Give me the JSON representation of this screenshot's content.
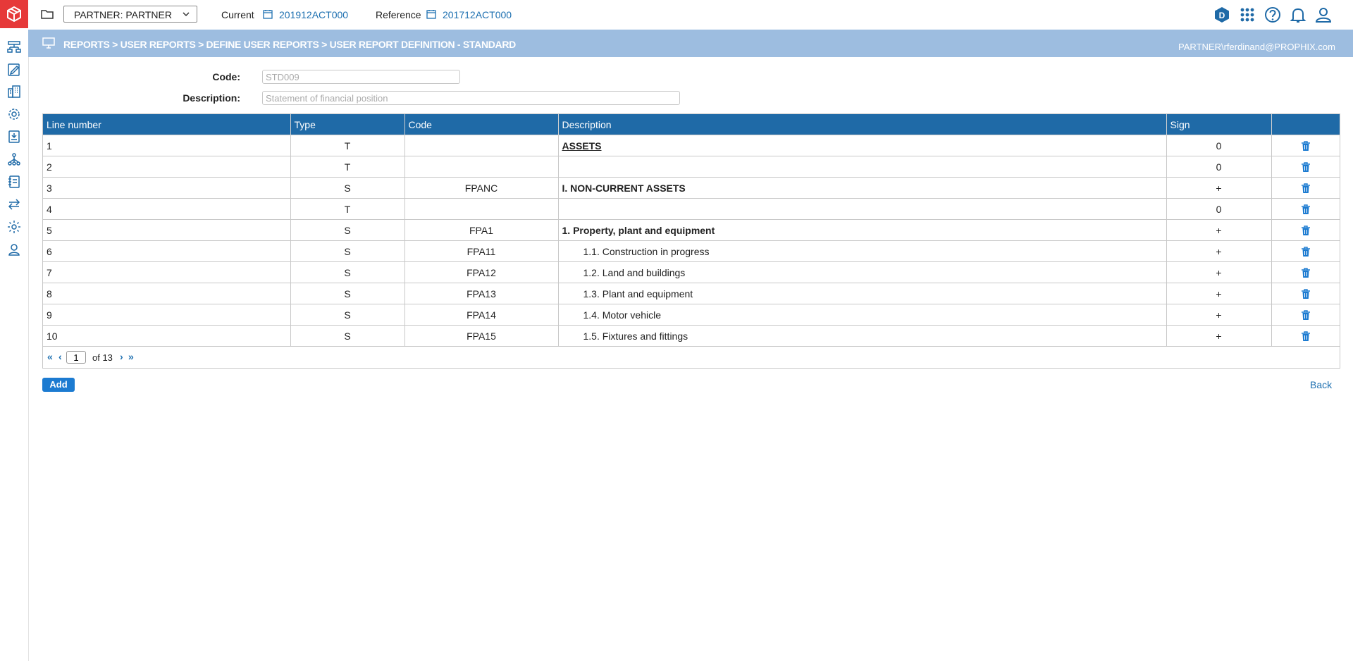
{
  "topbar": {
    "entity_selector": "PARTNER: PARTNER",
    "current_label": "Current",
    "current_value": "201912ACT000",
    "reference_label": "Reference",
    "reference_value": "201712ACT000",
    "badge_letter": "D"
  },
  "titlebar": {
    "breadcrumb": "REPORTS > USER REPORTS > DEFINE USER REPORTS > USER REPORT DEFINITION - STANDARD",
    "user": "PARTNER\\rferdinand@PROPHIX.com"
  },
  "form": {
    "code_label": "Code:",
    "code_value": "STD009",
    "description_label": "Description:",
    "description_value": "Statement of financial position"
  },
  "table": {
    "headers": [
      "Line number",
      "Type",
      "Code",
      "Description",
      "Sign",
      ""
    ],
    "rows": [
      {
        "line": "1",
        "type": "T",
        "code": "",
        "description": "ASSETS",
        "sign": "0",
        "style": "underline"
      },
      {
        "line": "2",
        "type": "T",
        "code": "",
        "description": "",
        "sign": "0",
        "style": ""
      },
      {
        "line": "3",
        "type": "S",
        "code": "FPANC",
        "description": "I. NON-CURRENT ASSETS",
        "sign": "+",
        "style": "bold"
      },
      {
        "line": "4",
        "type": "T",
        "code": "",
        "description": "",
        "sign": "0",
        "style": ""
      },
      {
        "line": "5",
        "type": "S",
        "code": "FPA1",
        "description": "1. Property, plant and equipment",
        "sign": "+",
        "style": "bold"
      },
      {
        "line": "6",
        "type": "S",
        "code": "FPA11",
        "description": "1.1. Construction in progress",
        "sign": "+",
        "style": "indent"
      },
      {
        "line": "7",
        "type": "S",
        "code": "FPA12",
        "description": "1.2. Land and buildings",
        "sign": "+",
        "style": "indent"
      },
      {
        "line": "8",
        "type": "S",
        "code": "FPA13",
        "description": "1.3. Plant and equipment",
        "sign": "+",
        "style": "indent"
      },
      {
        "line": "9",
        "type": "S",
        "code": "FPA14",
        "description": "1.4. Motor vehicle",
        "sign": "+",
        "style": "indent"
      },
      {
        "line": "10",
        "type": "S",
        "code": "FPA15",
        "description": "1.5. Fixtures and fittings",
        "sign": "+",
        "style": "indent"
      }
    ]
  },
  "pager": {
    "first": "«",
    "prev": "‹",
    "current_page": "1",
    "of_text": "of 13",
    "next": "›",
    "last": "»"
  },
  "actions": {
    "add_label": "Add",
    "back_label": "Back"
  },
  "colors": {
    "brand_red": "#e63939",
    "header_blue": "#1f6aa7",
    "titlebar_blue": "#9dbde0",
    "link_blue": "#1c6fb0"
  },
  "sidebar_icons": [
    "hierarchy-report-icon",
    "edit-form-icon",
    "building-icon",
    "gear-network-icon",
    "import-doc-icon",
    "org-tree-icon",
    "notebook-icon",
    "transfer-arrows-icon",
    "settings-gear-icon",
    "user-pin-icon"
  ]
}
